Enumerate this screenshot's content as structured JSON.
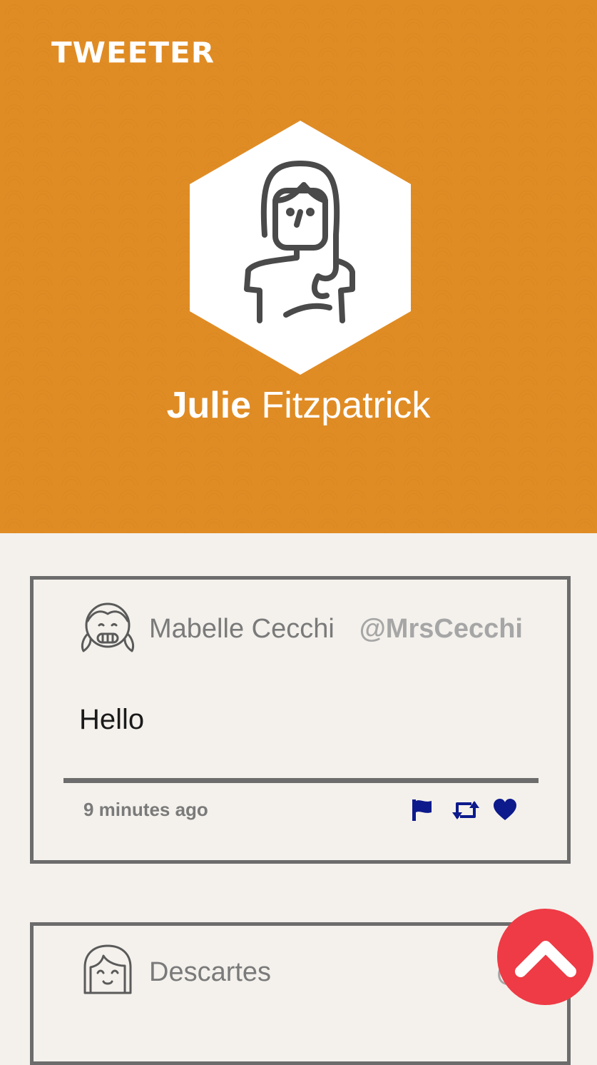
{
  "header": {
    "brand": "TWEETER",
    "profile": {
      "first_name": "Julie",
      "last_name": "Fitzpatrick",
      "avatar_icon": "woman-avatar-icon"
    },
    "colors": {
      "banner": "#e08c24"
    }
  },
  "tweets": [
    {
      "author_name": "Mabelle Cecchi",
      "handle": "@MrsCecchi",
      "text": "Hello",
      "time": "9 minutes ago",
      "avatar_icon": "girl-pigtails-avatar-icon",
      "actions": [
        "flag-icon",
        "retweet-icon",
        "heart-icon"
      ]
    },
    {
      "author_name": "Descartes",
      "handle": "@",
      "avatar_icon": "girl-bob-avatar-icon"
    }
  ],
  "scroll_top_icon": "chevron-up-icon",
  "colors": {
    "action": "#0d1a8c",
    "scroll_button": "#ee3b45",
    "background": "#f4f1ec"
  }
}
